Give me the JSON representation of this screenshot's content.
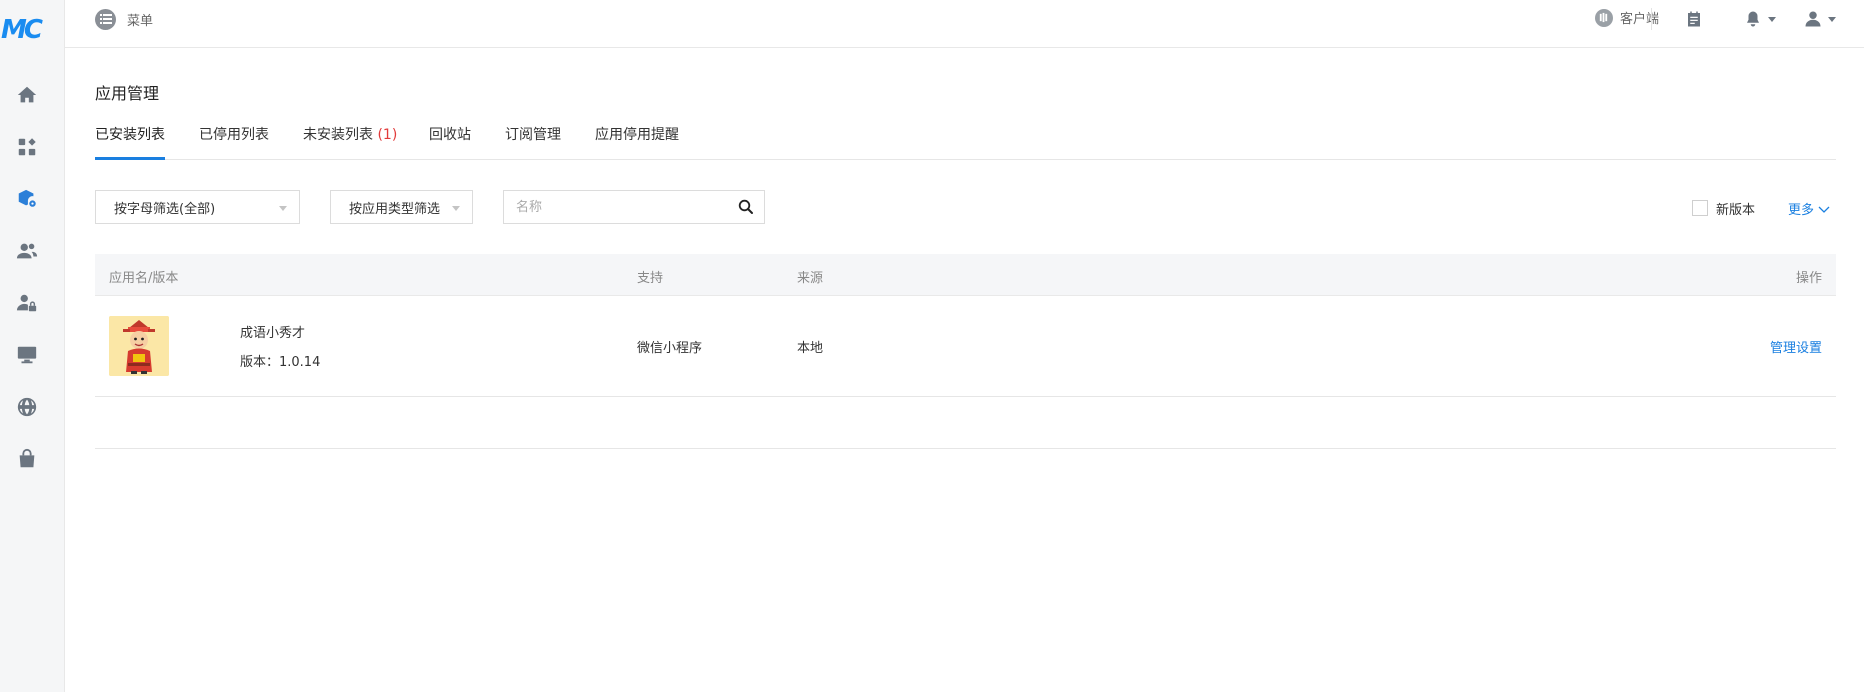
{
  "sidebar": {
    "logo_text": "MC",
    "items": [
      {
        "icon": "home-icon"
      },
      {
        "icon": "apps-grid-icon"
      },
      {
        "icon": "app-settings-icon",
        "active": true
      },
      {
        "icon": "users-icon"
      },
      {
        "icon": "user-lock-icon"
      },
      {
        "icon": "monitor-icon"
      },
      {
        "icon": "globe-icon"
      },
      {
        "icon": "shopping-bag-icon"
      }
    ],
    "active_color": "#2b7fd8"
  },
  "topbar": {
    "menu_label": "菜单",
    "client_label": "客户端"
  },
  "page": {
    "title": "应用管理",
    "tabs": [
      {
        "label": "已安装列表",
        "active": true
      },
      {
        "label": "已停用列表"
      },
      {
        "label": "未安装列表",
        "count": "(1)"
      },
      {
        "label": "回收站"
      },
      {
        "label": "订阅管理"
      },
      {
        "label": "应用停用提醒"
      }
    ]
  },
  "filters": {
    "letter_filter": "按字母筛选(全部)",
    "type_filter": "按应用类型筛选",
    "search_placeholder": "名称",
    "search_value": "",
    "new_version_label": "新版本",
    "new_version_checked": false,
    "more_label": "更多"
  },
  "table": {
    "columns": [
      "应用名/版本",
      "支持",
      "来源",
      "操作"
    ],
    "rows": [
      {
        "name": "成语小秀才",
        "version": "版本：1.0.14",
        "support": "微信小程序",
        "source": "本地",
        "action": "管理设置"
      }
    ]
  },
  "colors": {
    "accent": "#1a7fe0",
    "count_red": "#e23b3b"
  }
}
